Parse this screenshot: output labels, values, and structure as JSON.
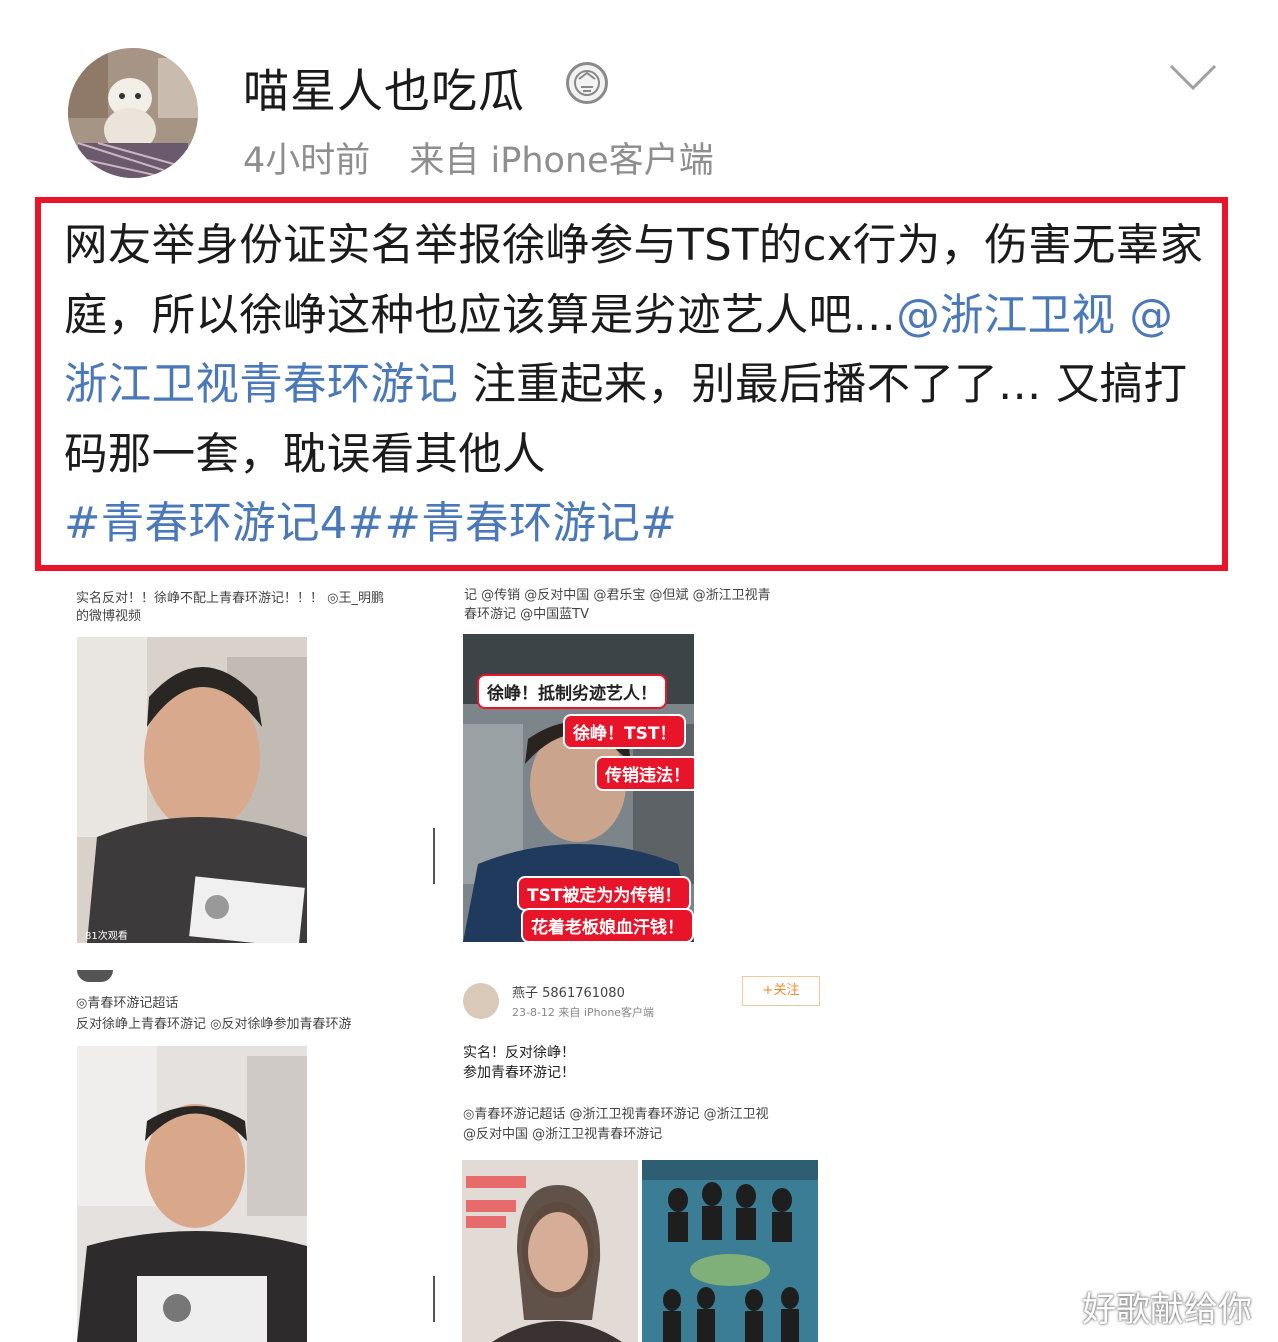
{
  "post": {
    "username": "喵星人也吃瓜",
    "time": "4小时前",
    "source": "来自 iPhone客户端",
    "text_part1": "网友举身份证实名举报徐峥参与TST的cx行为，伤害无辜家庭，所以徐峥这种也应该算是劣迹艺人吧…",
    "mention1": "@浙江卫视",
    "mention2": "@浙江卫视青春环游记",
    "text_part2": " 注重起来，别最后播不了了… 又搞打码那一套，耽误看其他人",
    "tag1": "#青春环游记4#",
    "tag2": "#青春环游记#"
  },
  "screens": {
    "s1_caption_line1": "实名反对！！徐峥不配上青春环游记！！！ ◎王_明鹏",
    "s1_caption_line2": "的微博视频",
    "s1_viewcount": "81次观看",
    "s2_caption_line1": "记 @传销 @反对中国 @君乐宝 @但斌 @浙江卫视青",
    "s2_caption_line2": "春环游记 @中国蓝TV",
    "s2_tag1": "徐峥！抵制劣迹艺人！",
    "s2_tag2": "徐峥！TST！",
    "s2_tag3": "传销违法！",
    "s2_tag4": "TST被定为为传销！",
    "s2_tag5": "花着老板娘血汗钱！",
    "s3_caption_line1": "◎青春环游记超话",
    "s3_caption_line2": "反对徐峥上青春环游记 ◎反对徐峥参加青春环游",
    "s4_user": "燕子 5861761080",
    "s4_time": "23-8-12 来自 iPhone客户端",
    "s4_text1": "实名！反对徐峥！",
    "s4_text2": "参加青春环游记！",
    "s4_caption_line1": "◎青春环游记超话 @浙江卫视青春环游记 @浙江卫视",
    "s4_caption_line2": "@反对中国 @浙江卫视青春环游记",
    "s4_follow": "+关注"
  },
  "watermark": "好歌献给你",
  "colors": {
    "accent_red": "#e8142a",
    "link_blue": "#4a78b8",
    "meta_gray": "#8e8e8e"
  },
  "icons": [
    "chevron-down-icon",
    "medal-badge-icon"
  ]
}
